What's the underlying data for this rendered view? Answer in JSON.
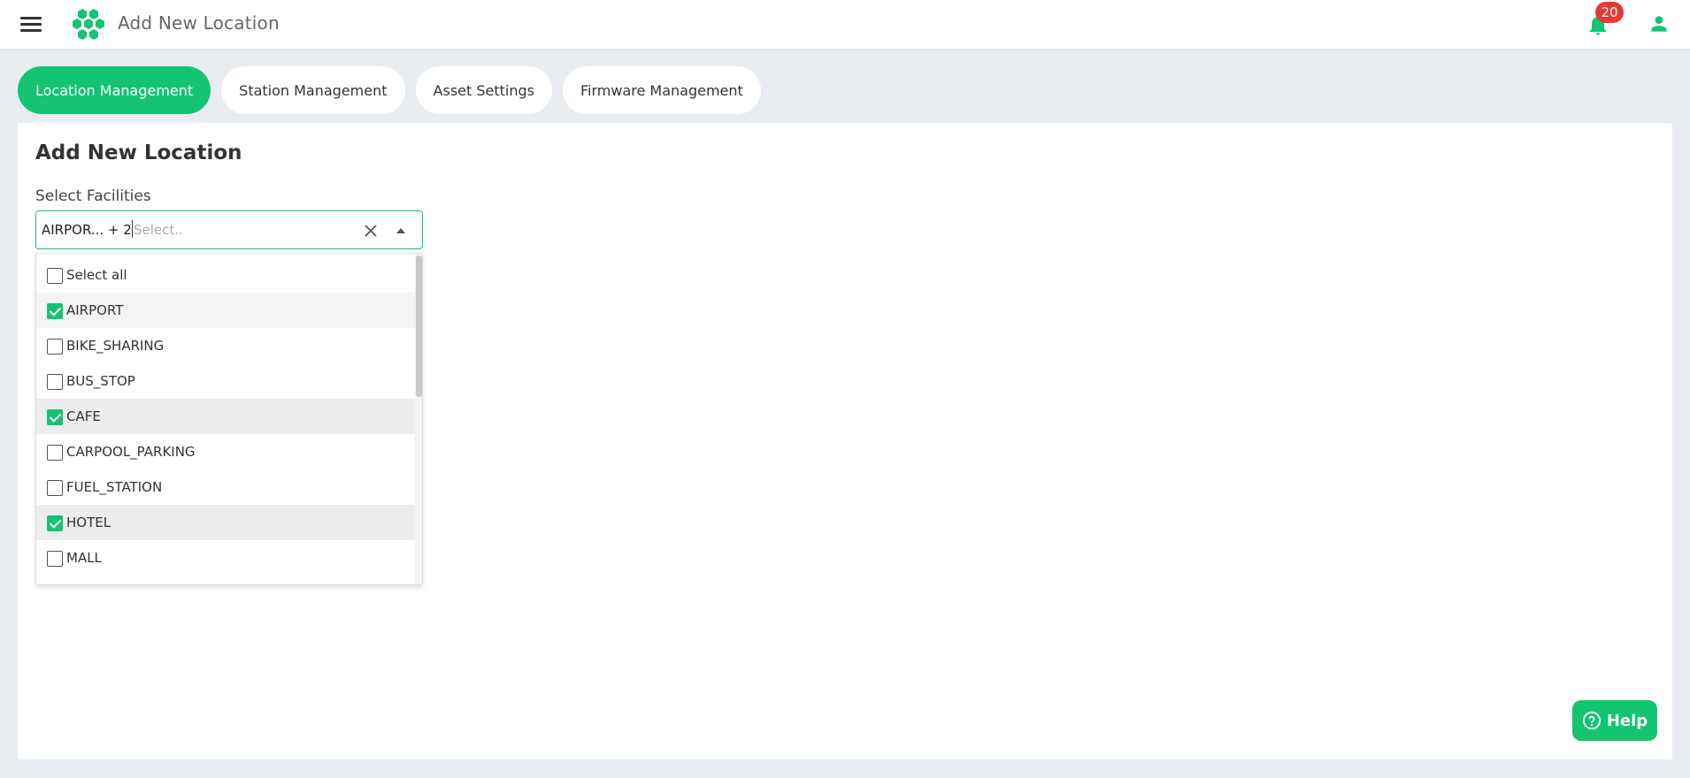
{
  "header": {
    "title": "Add New Location",
    "notification_count": "20"
  },
  "tabs": [
    {
      "label": "Location Management",
      "active": true
    },
    {
      "label": "Station Management",
      "active": false
    },
    {
      "label": "Asset Settings",
      "active": false
    },
    {
      "label": "Firmware Management",
      "active": false
    }
  ],
  "main": {
    "page_title": "Add New Location",
    "facilities_label": "Select Facilities",
    "selected_summary": "AIRPOR... + 2",
    "search_placeholder": "Select..",
    "options": [
      {
        "label": "Select all",
        "checked": false
      },
      {
        "label": "AIRPORT",
        "checked": true
      },
      {
        "label": "BIKE_SHARING",
        "checked": false
      },
      {
        "label": "BUS_STOP",
        "checked": false
      },
      {
        "label": "CAFE",
        "checked": true
      },
      {
        "label": "CARPOOL_PARKING",
        "checked": false
      },
      {
        "label": "FUEL_STATION",
        "checked": false
      },
      {
        "label": "HOTEL",
        "checked": true
      },
      {
        "label": "MALL",
        "checked": false
      }
    ]
  },
  "help": {
    "label": "Help"
  },
  "colors": {
    "accent": "#14c471",
    "badge": "#e53935",
    "background": "#e9edf2"
  }
}
